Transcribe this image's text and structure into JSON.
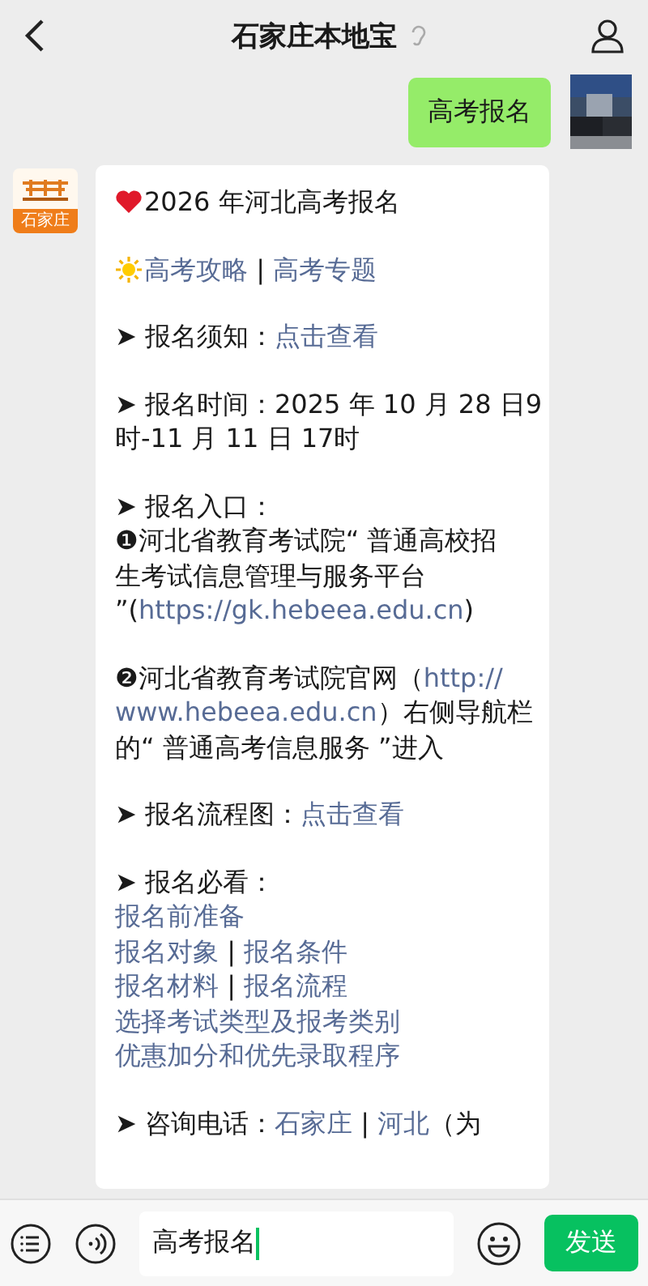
{
  "header": {
    "title": "石家庄本地宝"
  },
  "sent": {
    "text": "高考报名"
  },
  "received": {
    "avatar_label": "石家庄",
    "blocks": [
      {
        "lines": [
          [
            {
              "kind": "heart"
            },
            {
              "kind": "text",
              "text": "2026 年河北高考报名"
            }
          ]
        ]
      },
      {
        "lines": [
          [
            {
              "kind": "sun"
            },
            {
              "kind": "link",
              "text": "高考攻略"
            },
            {
              "kind": "text",
              "text": " | "
            },
            {
              "kind": "link",
              "text": "高考专题"
            }
          ]
        ]
      },
      {
        "lines": [
          [
            {
              "kind": "text",
              "text": "➤ 报名须知："
            },
            {
              "kind": "link",
              "text": "点击查看"
            }
          ]
        ]
      },
      {
        "lines": [
          [
            {
              "kind": "text",
              "text": "➤ 报名时间：2025 年 10 月 28 日9"
            }
          ],
          [
            {
              "kind": "text",
              "text": "时-11 月 11 日 17时"
            }
          ]
        ]
      },
      {
        "lines": [
          [
            {
              "kind": "text",
              "text": "➤ 报名入口："
            }
          ],
          [
            {
              "kind": "text",
              "text": "❶河北省教育考试院“ 普通高校招"
            }
          ],
          [
            {
              "kind": "text",
              "text": "生考试信息管理与服务平台"
            }
          ],
          [
            {
              "kind": "text",
              "text": "”("
            },
            {
              "kind": "link",
              "text": "https://gk.hebeea.edu.cn"
            },
            {
              "kind": "text",
              "text": ")"
            }
          ]
        ]
      },
      {
        "lines": [
          [
            {
              "kind": "text",
              "text": "❷河北省教育考试院官网（"
            },
            {
              "kind": "link",
              "text": "http://"
            }
          ],
          [
            {
              "kind": "link",
              "text": "www.hebeea.edu.cn"
            },
            {
              "kind": "text",
              "text": "）右侧导航栏"
            }
          ],
          [
            {
              "kind": "text",
              "text": "的“ 普通高考信息服务 ”进入"
            }
          ]
        ]
      },
      {
        "lines": [
          [
            {
              "kind": "text",
              "text": "➤ 报名流程图："
            },
            {
              "kind": "link",
              "text": "点击查看"
            }
          ]
        ]
      },
      {
        "lines": [
          [
            {
              "kind": "text",
              "text": "➤ 报名必看："
            }
          ],
          [
            {
              "kind": "link",
              "text": "报名前准备"
            }
          ],
          [
            {
              "kind": "link",
              "text": "报名对象"
            },
            {
              "kind": "text",
              "text": " | "
            },
            {
              "kind": "link",
              "text": "报名条件"
            }
          ],
          [
            {
              "kind": "link",
              "text": "报名材料"
            },
            {
              "kind": "text",
              "text": " | "
            },
            {
              "kind": "link",
              "text": "报名流程"
            }
          ],
          [
            {
              "kind": "link",
              "text": "选择考试类型及报考类别"
            }
          ],
          [
            {
              "kind": "link",
              "text": "优惠加分和优先录取程序"
            }
          ]
        ]
      },
      {
        "lines": [
          [
            {
              "kind": "text",
              "text": "➤ 咨询电话："
            },
            {
              "kind": "link",
              "text": "石家庄"
            },
            {
              "kind": "text",
              "text": " | "
            },
            {
              "kind": "link",
              "text": "河北"
            },
            {
              "kind": "text",
              "text": "（为"
            }
          ]
        ]
      }
    ]
  },
  "composer": {
    "value": "高考报名",
    "send": "发送"
  }
}
